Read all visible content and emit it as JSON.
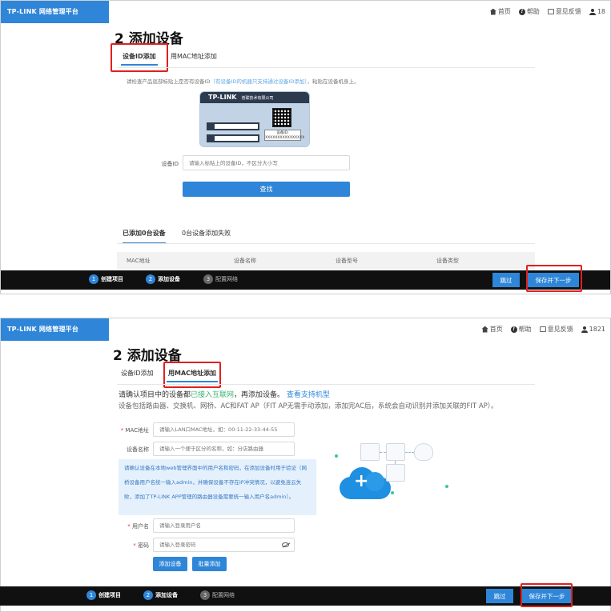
{
  "brand": "TP-LINK 网络管理平台",
  "header_links": {
    "home": "首页",
    "help": "帮助",
    "feedback": "意见反馈",
    "user_top": "18",
    "user_bottom": "1821"
  },
  "page_title": "2 添加设备",
  "tabs": {
    "device_id": "设备ID添加",
    "mac": "用MAC地址添加"
  },
  "panel1": {
    "hint_prefix": "请检查产品底部标贴上是否有设备ID",
    "hint_blue": "（有设备ID的机器只支持通过设备ID添加）",
    "hint_suffix": "，粘贴在设备机身上。",
    "label_brand": "TP-LINK",
    "label_company": "普联技术有限公司",
    "label_id_title": "设备ID:",
    "label_id_value": "XXXXXXXXXXXXXXXX",
    "device_id_label": "设备ID",
    "device_id_placeholder": "请输入标贴上的设备ID，不区分大小写",
    "search_button": "查找",
    "added_tab": "已添加0台设备",
    "failed_tab": "0台设备添加失败",
    "table_columns": [
      "MAC地址",
      "设备名称",
      "设备型号",
      "设备类型"
    ]
  },
  "panel2": {
    "confirm_prefix": "请确认项目中的设备都",
    "confirm_green": "已接入互联网",
    "confirm_middle": "，再添加设备。",
    "confirm_link": "查看支持机型",
    "desc": "设备包括路由器、交换机、网桥、AC和FAT AP（FIT AP无需手动添加，添加完AC后，系统会自动识别并添加关联的FIT AP）。",
    "mac_label": "MAC地址",
    "mac_placeholder": "请输入LAN口MAC地址，如：00-11-22-33-44-55",
    "name_label": "设备名称",
    "name_placeholder": "请输入一个便于区分的名称，如：分店路由器",
    "info_text": "请确认设备在本地web管理界面中的用户名和密码，在添加设备时用于验证（网桥设备用户名统一输入admin，并确保设备不存在IP冲突情况，以避免连云失败，添加了TP-LINK APP管理的路由器设备需要统一输入用户名admin）。",
    "username_label": "用户名",
    "username_placeholder": "请输入登录用户名",
    "password_label": "密码",
    "password_placeholder": "请输入登录密码",
    "add_button": "添加设备",
    "batch_button": "批量添加"
  },
  "footer": {
    "steps": [
      {
        "num": "1",
        "label": "创建项目"
      },
      {
        "num": "2",
        "label": "添加设备"
      },
      {
        "num": "3",
        "label": "配置网络"
      }
    ],
    "skip": "跳过",
    "save_next": "保存并下一步"
  },
  "colors": {
    "accent": "#2f86d8",
    "highlight": "#e02020",
    "footer_bg": "#101010",
    "success_green": "#3cb371"
  }
}
